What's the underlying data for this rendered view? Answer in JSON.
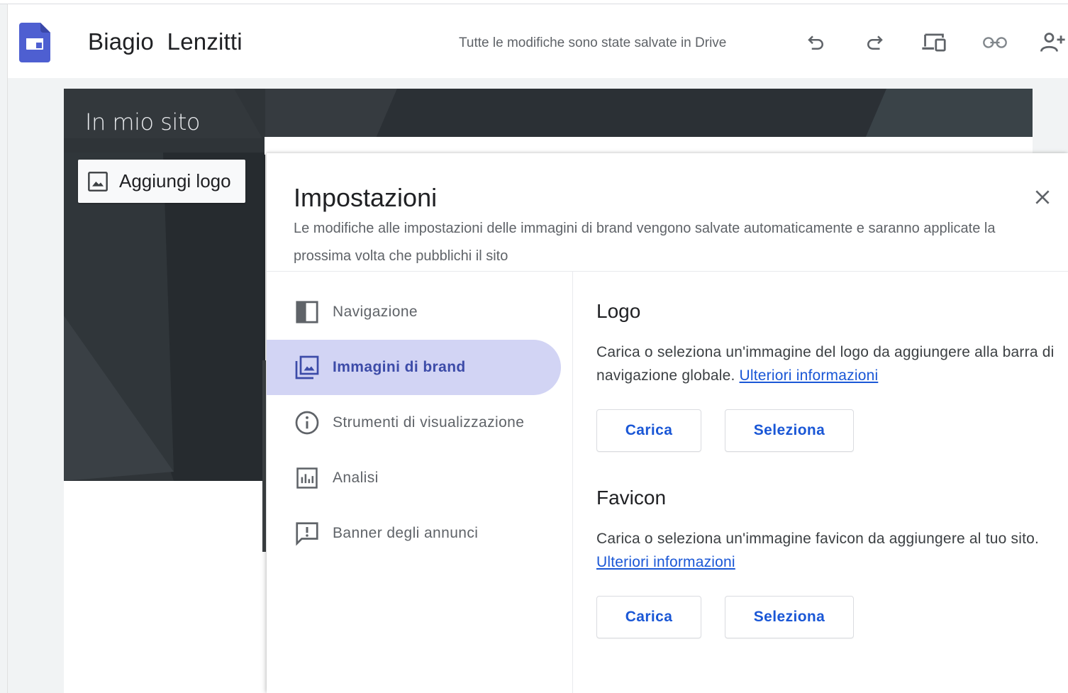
{
  "app": {
    "site_name": "Biagio  Lenzitti",
    "save_status": "Tutte le modifiche sono state salvate in Drive",
    "toolbar_icons": [
      "undo-icon",
      "redo-icon",
      "preview-device-icon",
      "link-icon",
      "share-person-icon"
    ]
  },
  "preview": {
    "site_title": "In mio sito",
    "add_logo_label": "Aggiungi logo"
  },
  "dialog": {
    "title": "Impostazioni",
    "subtitle": "Le modifiche alle impostazioni delle immagini di brand vengono salvate automaticamente e saranno applicate la prossima volta che pubblichi il sito",
    "nav": [
      {
        "label": "Navigazione",
        "icon": "navigation-panel-icon",
        "active": false
      },
      {
        "label": "Immagini di brand",
        "icon": "brand-images-icon",
        "active": true
      },
      {
        "label": "Strumenti di visualizzazione",
        "icon": "info-icon",
        "active": false
      },
      {
        "label": "Analisi",
        "icon": "analytics-icon",
        "active": false
      },
      {
        "label": "Banner degli annunci",
        "icon": "announcement-icon",
        "active": false
      }
    ],
    "logo": {
      "title": "Logo",
      "description": "Carica o seleziona un'immagine del logo da aggiungere alla barra di navigazione globale. ",
      "learn_more": "Ulteriori informazioni",
      "upload": "Carica",
      "select": "Seleziona"
    },
    "favicon": {
      "title": "Favicon",
      "description": "Carica o seleziona un'immagine favicon da aggiungere al tuo sito. ",
      "learn_more": "Ulteriori informazioni",
      "upload": "Carica",
      "select": "Seleziona"
    }
  },
  "colors": {
    "accent": "#1a57d6",
    "active_nav_bg": "#d2d4f4",
    "app_icon": "#4e5fd1",
    "hero_dark": "#2f3438"
  }
}
